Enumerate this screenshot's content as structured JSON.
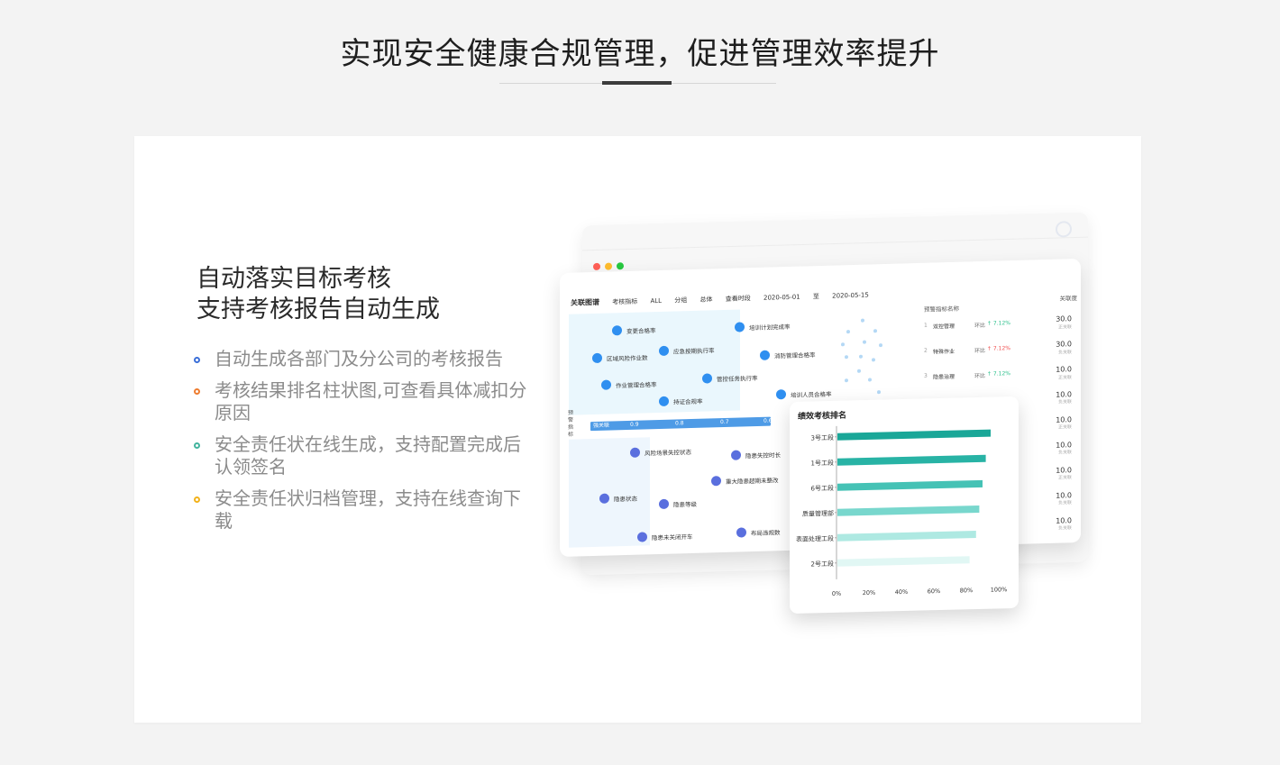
{
  "page": {
    "title": "实现安全健康合规管理，促进管理效率提升"
  },
  "feature": {
    "headline_line1": "自动落实目标考核",
    "headline_line2": "支持考核报告自动生成",
    "items": [
      {
        "text": "自动生成各部门及分公司的考核报告",
        "bullet_color": "#3b6fd8"
      },
      {
        "text": "考核结果排名柱状图,可查看具体减扣分原因",
        "bullet_color": "#ee7d31"
      },
      {
        "text": "安全责任状在线生成，支持配置完成后认领签名",
        "bullet_color": "#43b49e"
      },
      {
        "text": "安全责任状归档管理，支持在线查询下载",
        "bullet_color": "#f2b21b"
      }
    ]
  },
  "mockup": {
    "window_dots": [
      "#ff5f57",
      "#febc2e",
      "#28c840"
    ],
    "header": {
      "tab": "关联图谱",
      "indicator_label": "考核指标",
      "indicator_value": "ALL",
      "group_label": "分组",
      "group_value": "总体",
      "period_label": "查看时段",
      "date_from": "2020-05-01",
      "date_sep": "至",
      "date_to": "2020-05-15"
    },
    "axis_label": "强关联",
    "axis_ticks": [
      "0.9",
      "0.8",
      "0.7",
      "0.6"
    ],
    "side_vertical_label": "预警指标",
    "nodes_top": [
      "变更合格率",
      "培训计划完成率",
      "区域风险作业数",
      "应急按期执行率",
      "消防管理合格率",
      "作业管理合格率",
      "管控任务执行率",
      "持证合规率",
      "培训人员合格率"
    ],
    "nodes_bottom": [
      "风险场景失控状态",
      "隐患失控时长",
      "重大隐患超期未整改",
      "隐患状态",
      "隐患等级",
      "隐患未关闭开车",
      "布局违规数"
    ],
    "warning_list": {
      "title": "预警指标名称",
      "score_title": "关联度",
      "rows": [
        {
          "idx": "1",
          "name": "双控管理",
          "ratio_label": "环比",
          "ratio": "↑ 7.12%",
          "score": "30.0",
          "tag": "正关联"
        },
        {
          "idx": "2",
          "name": "特殊作业",
          "ratio_label": "环比",
          "ratio": "↑ 7.12%",
          "score": "30.0",
          "tag": "负关联"
        },
        {
          "idx": "3",
          "name": "隐患治理",
          "ratio_label": "环比",
          "ratio": "↑ 7.12%",
          "score": "10.0",
          "tag": "正关联"
        }
      ],
      "extra_scores": [
        {
          "score": "10.0",
          "tag": "负关联"
        },
        {
          "score": "10.0",
          "tag": "正关联"
        },
        {
          "score": "10.0",
          "tag": "负关联"
        },
        {
          "score": "10.0",
          "tag": "正关联"
        },
        {
          "score": "10.0",
          "tag": "负关联"
        },
        {
          "score": "10.0",
          "tag": "负关联"
        }
      ]
    },
    "ratio_up_color": "#2cc08c",
    "ratio_down_color": "#f04d4d"
  },
  "chart_data": {
    "type": "bar",
    "orientation": "horizontal",
    "title": "绩效考核排名",
    "categories": [
      "3号工段",
      "1号工段",
      "6号工段",
      "质量管理部",
      "表面处理工段",
      "2号工段"
    ],
    "values": [
      95,
      92,
      90,
      88,
      86,
      82
    ],
    "xlim": [
      0,
      100
    ],
    "x_ticks": [
      "0%",
      "20%",
      "40%",
      "60%",
      "80%",
      "100%"
    ],
    "bar_colors": [
      "#1aa798",
      "#28b3a5",
      "#45c2b5",
      "#78d7cd",
      "#aee9e2",
      "#e1f7f4"
    ]
  }
}
